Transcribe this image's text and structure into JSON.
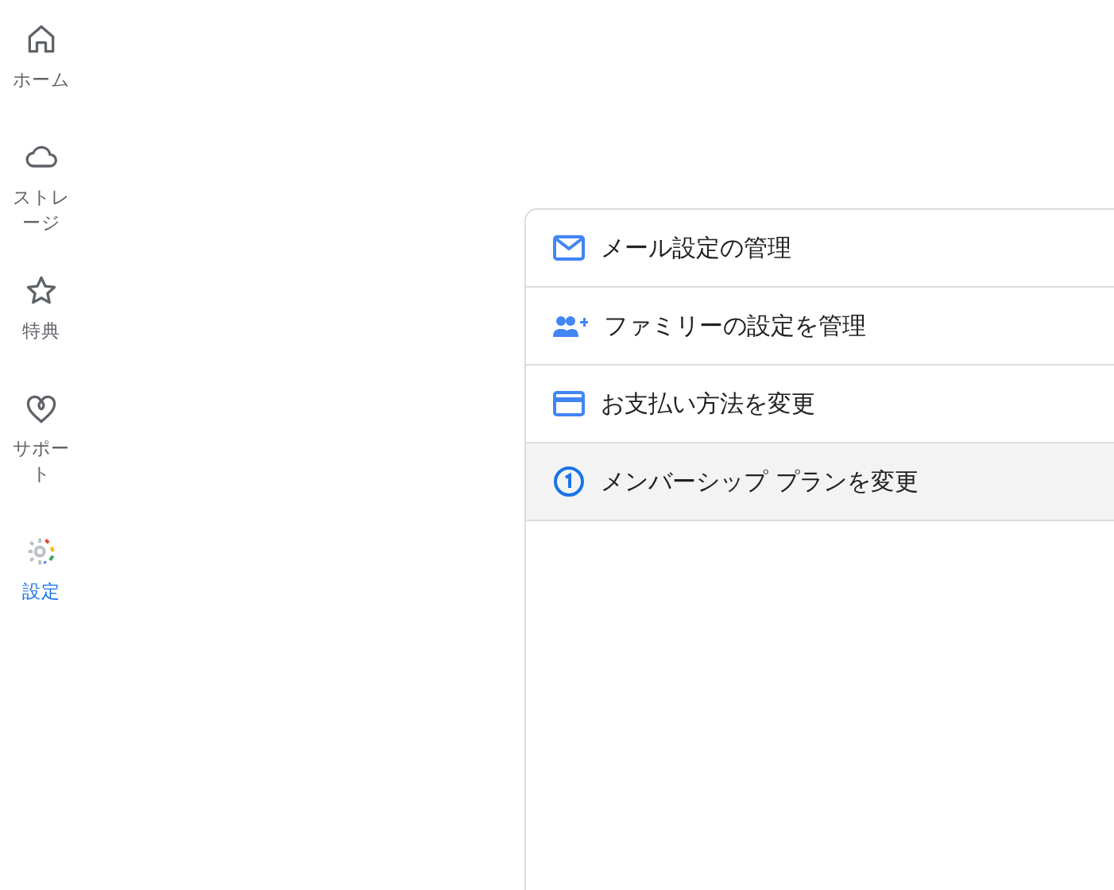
{
  "nav": [
    {
      "kind": "home",
      "label": "ホーム",
      "selected": false
    },
    {
      "kind": "storage",
      "label": "ストレージ",
      "selected": false
    },
    {
      "kind": "benefits",
      "label": "特典",
      "selected": false
    },
    {
      "kind": "support",
      "label": "サポート",
      "selected": false
    },
    {
      "kind": "settings",
      "label": "設定",
      "selected": true
    }
  ],
  "menu": [
    {
      "kind": "mail",
      "label": "メール設定の管理",
      "selected": false
    },
    {
      "kind": "family",
      "label": "ファミリーの設定を管理",
      "selected": false
    },
    {
      "kind": "payment",
      "label": "お支払い方法を変更",
      "selected": false
    },
    {
      "kind": "plan",
      "label": "メンバーシップ プランを変更",
      "selected": true
    }
  ]
}
